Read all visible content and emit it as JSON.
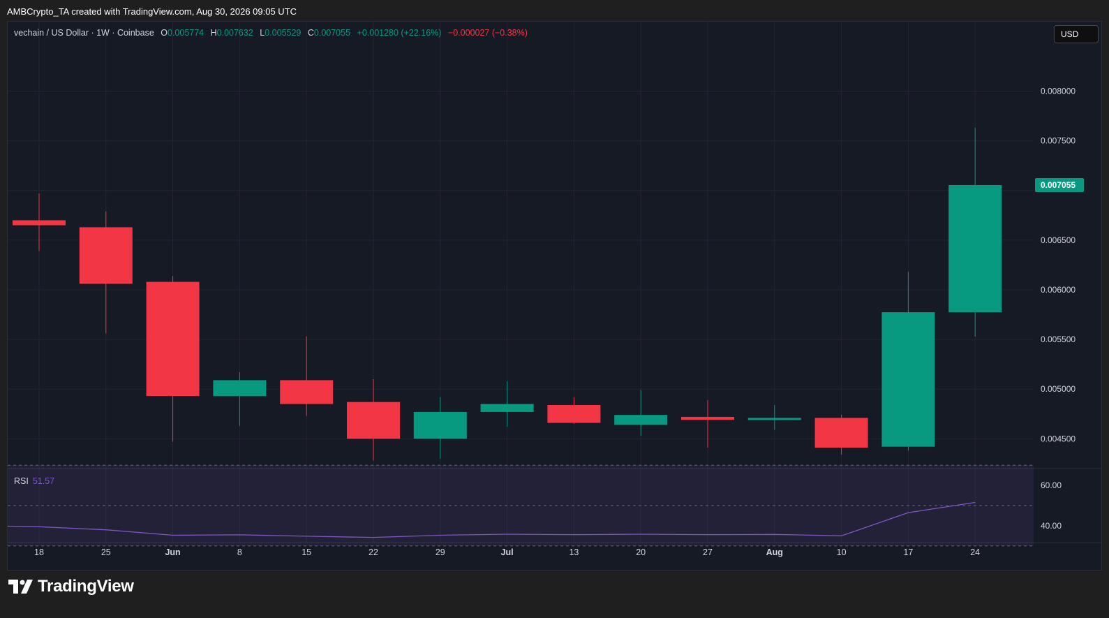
{
  "header": {
    "credit": "AMBCrypto_TA created with TradingView.com, Aug 30, 2026 09:05 UTC"
  },
  "legend": {
    "symbol": "vechain / US Dollar · 1W · Coinbase",
    "o_label": "O",
    "o_value": "0.005774",
    "h_label": "H",
    "h_value": "0.007632",
    "l_label": "L",
    "l_value": "0.005529",
    "c_label": "C",
    "c_value": "0.007055",
    "change": "+0.001280 (+22.16%)",
    "change2": "−0.000027 (−0.38%)"
  },
  "currency_button": "USD",
  "rsi_legend": {
    "name": "RSI",
    "value": "51.57"
  },
  "brand": {
    "logo_text": "TradingView"
  },
  "colors": {
    "up": "#089981",
    "down": "#f23645",
    "rsi_line": "#7e57c2",
    "background": "#161a25",
    "grid": "#232632"
  },
  "chart_data": [
    {
      "type": "candlestick",
      "title": "",
      "ylim": [
        0.0042,
        0.0087
      ],
      "price_ticks": [
        "0.008000",
        "0.007500",
        "0.006500",
        "0.006000",
        "0.005500",
        "0.005000",
        "0.004500"
      ],
      "price_tick_values": [
        0.008,
        0.0075,
        0.0065,
        0.006,
        0.0055,
        0.005,
        0.0045
      ],
      "last_price_label": "0.007055",
      "last_price": 0.007055,
      "x_labels": [
        "18",
        "25",
        "Jun",
        "8",
        "15",
        "22",
        "29",
        "Jul",
        "13",
        "20",
        "27",
        "Aug",
        "10",
        "17",
        "24"
      ],
      "candles": [
        {
          "o": 0.0067,
          "h": 0.00697,
          "l": 0.00639,
          "c": 0.00665
        },
        {
          "o": 0.00663,
          "h": 0.00679,
          "l": 0.00556,
          "c": 0.00606
        },
        {
          "o": 0.00608,
          "h": 0.00614,
          "l": 0.00447,
          "c": 0.00493
        },
        {
          "o": 0.00493,
          "h": 0.00517,
          "l": 0.00463,
          "c": 0.00509
        },
        {
          "o": 0.00509,
          "h": 0.00553,
          "l": 0.00473,
          "c": 0.00485
        },
        {
          "o": 0.00487,
          "h": 0.0051,
          "l": 0.00428,
          "c": 0.0045
        },
        {
          "o": 0.0045,
          "h": 0.00492,
          "l": 0.0043,
          "c": 0.00477
        },
        {
          "o": 0.00477,
          "h": 0.00508,
          "l": 0.00462,
          "c": 0.00485
        },
        {
          "o": 0.00484,
          "h": 0.00492,
          "l": 0.00465,
          "c": 0.00466
        },
        {
          "o": 0.00464,
          "h": 0.00499,
          "l": 0.00453,
          "c": 0.00474
        },
        {
          "o": 0.00472,
          "h": 0.00489,
          "l": 0.00441,
          "c": 0.00469
        },
        {
          "o": 0.0047,
          "h": 0.00484,
          "l": 0.00459,
          "c": 0.00471
        },
        {
          "o": 0.00471,
          "h": 0.00474,
          "l": 0.00434,
          "c": 0.00441
        },
        {
          "o": 0.00442,
          "h": 0.00618,
          "l": 0.00438,
          "c": 0.005774
        },
        {
          "o": 0.005774,
          "h": 0.007632,
          "l": 0.005529,
          "c": 0.007055
        }
      ]
    },
    {
      "type": "line",
      "title": "RSI",
      "ylim": [
        32,
        68
      ],
      "y_ticks": [
        "60.00",
        "40.00"
      ],
      "y_tick_values": [
        60,
        40
      ],
      "band": [
        30,
        70
      ],
      "x_labels": [
        "18",
        "25",
        "Jun",
        "8",
        "15",
        "22",
        "29",
        "Jul",
        "13",
        "20",
        "27",
        "Aug",
        "10",
        "17",
        "24"
      ],
      "values": [
        39.5,
        38.0,
        35.3,
        35.5,
        34.8,
        34.2,
        35.3,
        35.8,
        35.6,
        35.8,
        35.6,
        35.7,
        35.0,
        46.5,
        51.57
      ]
    }
  ]
}
